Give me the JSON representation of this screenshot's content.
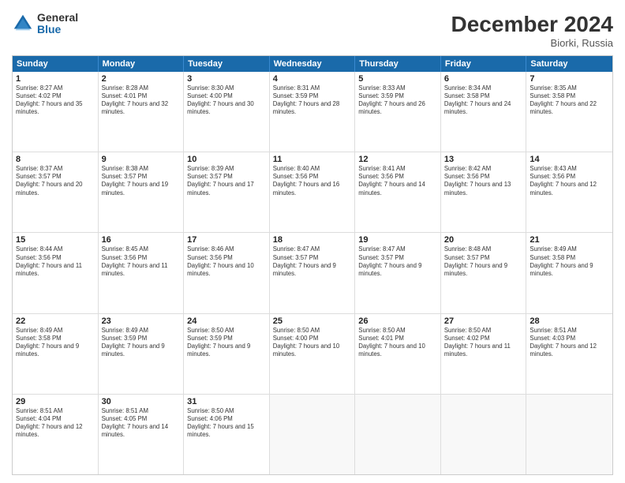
{
  "logo": {
    "general": "General",
    "blue": "Blue"
  },
  "title": "December 2024",
  "location": "Biorki, Russia",
  "days_header": [
    "Sunday",
    "Monday",
    "Tuesday",
    "Wednesday",
    "Thursday",
    "Friday",
    "Saturday"
  ],
  "weeks": [
    [
      {
        "day": "1",
        "sunrise": "Sunrise: 8:27 AM",
        "sunset": "Sunset: 4:02 PM",
        "daylight": "Daylight: 7 hours and 35 minutes."
      },
      {
        "day": "2",
        "sunrise": "Sunrise: 8:28 AM",
        "sunset": "Sunset: 4:01 PM",
        "daylight": "Daylight: 7 hours and 32 minutes."
      },
      {
        "day": "3",
        "sunrise": "Sunrise: 8:30 AM",
        "sunset": "Sunset: 4:00 PM",
        "daylight": "Daylight: 7 hours and 30 minutes."
      },
      {
        "day": "4",
        "sunrise": "Sunrise: 8:31 AM",
        "sunset": "Sunset: 3:59 PM",
        "daylight": "Daylight: 7 hours and 28 minutes."
      },
      {
        "day": "5",
        "sunrise": "Sunrise: 8:33 AM",
        "sunset": "Sunset: 3:59 PM",
        "daylight": "Daylight: 7 hours and 26 minutes."
      },
      {
        "day": "6",
        "sunrise": "Sunrise: 8:34 AM",
        "sunset": "Sunset: 3:58 PM",
        "daylight": "Daylight: 7 hours and 24 minutes."
      },
      {
        "day": "7",
        "sunrise": "Sunrise: 8:35 AM",
        "sunset": "Sunset: 3:58 PM",
        "daylight": "Daylight: 7 hours and 22 minutes."
      }
    ],
    [
      {
        "day": "8",
        "sunrise": "Sunrise: 8:37 AM",
        "sunset": "Sunset: 3:57 PM",
        "daylight": "Daylight: 7 hours and 20 minutes."
      },
      {
        "day": "9",
        "sunrise": "Sunrise: 8:38 AM",
        "sunset": "Sunset: 3:57 PM",
        "daylight": "Daylight: 7 hours and 19 minutes."
      },
      {
        "day": "10",
        "sunrise": "Sunrise: 8:39 AM",
        "sunset": "Sunset: 3:57 PM",
        "daylight": "Daylight: 7 hours and 17 minutes."
      },
      {
        "day": "11",
        "sunrise": "Sunrise: 8:40 AM",
        "sunset": "Sunset: 3:56 PM",
        "daylight": "Daylight: 7 hours and 16 minutes."
      },
      {
        "day": "12",
        "sunrise": "Sunrise: 8:41 AM",
        "sunset": "Sunset: 3:56 PM",
        "daylight": "Daylight: 7 hours and 14 minutes."
      },
      {
        "day": "13",
        "sunrise": "Sunrise: 8:42 AM",
        "sunset": "Sunset: 3:56 PM",
        "daylight": "Daylight: 7 hours and 13 minutes."
      },
      {
        "day": "14",
        "sunrise": "Sunrise: 8:43 AM",
        "sunset": "Sunset: 3:56 PM",
        "daylight": "Daylight: 7 hours and 12 minutes."
      }
    ],
    [
      {
        "day": "15",
        "sunrise": "Sunrise: 8:44 AM",
        "sunset": "Sunset: 3:56 PM",
        "daylight": "Daylight: 7 hours and 11 minutes."
      },
      {
        "day": "16",
        "sunrise": "Sunrise: 8:45 AM",
        "sunset": "Sunset: 3:56 PM",
        "daylight": "Daylight: 7 hours and 11 minutes."
      },
      {
        "day": "17",
        "sunrise": "Sunrise: 8:46 AM",
        "sunset": "Sunset: 3:56 PM",
        "daylight": "Daylight: 7 hours and 10 minutes."
      },
      {
        "day": "18",
        "sunrise": "Sunrise: 8:47 AM",
        "sunset": "Sunset: 3:57 PM",
        "daylight": "Daylight: 7 hours and 9 minutes."
      },
      {
        "day": "19",
        "sunrise": "Sunrise: 8:47 AM",
        "sunset": "Sunset: 3:57 PM",
        "daylight": "Daylight: 7 hours and 9 minutes."
      },
      {
        "day": "20",
        "sunrise": "Sunrise: 8:48 AM",
        "sunset": "Sunset: 3:57 PM",
        "daylight": "Daylight: 7 hours and 9 minutes."
      },
      {
        "day": "21",
        "sunrise": "Sunrise: 8:49 AM",
        "sunset": "Sunset: 3:58 PM",
        "daylight": "Daylight: 7 hours and 9 minutes."
      }
    ],
    [
      {
        "day": "22",
        "sunrise": "Sunrise: 8:49 AM",
        "sunset": "Sunset: 3:58 PM",
        "daylight": "Daylight: 7 hours and 9 minutes."
      },
      {
        "day": "23",
        "sunrise": "Sunrise: 8:49 AM",
        "sunset": "Sunset: 3:59 PM",
        "daylight": "Daylight: 7 hours and 9 minutes."
      },
      {
        "day": "24",
        "sunrise": "Sunrise: 8:50 AM",
        "sunset": "Sunset: 3:59 PM",
        "daylight": "Daylight: 7 hours and 9 minutes."
      },
      {
        "day": "25",
        "sunrise": "Sunrise: 8:50 AM",
        "sunset": "Sunset: 4:00 PM",
        "daylight": "Daylight: 7 hours and 10 minutes."
      },
      {
        "day": "26",
        "sunrise": "Sunrise: 8:50 AM",
        "sunset": "Sunset: 4:01 PM",
        "daylight": "Daylight: 7 hours and 10 minutes."
      },
      {
        "day": "27",
        "sunrise": "Sunrise: 8:50 AM",
        "sunset": "Sunset: 4:02 PM",
        "daylight": "Daylight: 7 hours and 11 minutes."
      },
      {
        "day": "28",
        "sunrise": "Sunrise: 8:51 AM",
        "sunset": "Sunset: 4:03 PM",
        "daylight": "Daylight: 7 hours and 12 minutes."
      }
    ],
    [
      {
        "day": "29",
        "sunrise": "Sunrise: 8:51 AM",
        "sunset": "Sunset: 4:04 PM",
        "daylight": "Daylight: 7 hours and 12 minutes."
      },
      {
        "day": "30",
        "sunrise": "Sunrise: 8:51 AM",
        "sunset": "Sunset: 4:05 PM",
        "daylight": "Daylight: 7 hours and 14 minutes."
      },
      {
        "day": "31",
        "sunrise": "Sunrise: 8:50 AM",
        "sunset": "Sunset: 4:06 PM",
        "daylight": "Daylight: 7 hours and 15 minutes."
      },
      {
        "day": "",
        "sunrise": "",
        "sunset": "",
        "daylight": ""
      },
      {
        "day": "",
        "sunrise": "",
        "sunset": "",
        "daylight": ""
      },
      {
        "day": "",
        "sunrise": "",
        "sunset": "",
        "daylight": ""
      },
      {
        "day": "",
        "sunrise": "",
        "sunset": "",
        "daylight": ""
      }
    ]
  ]
}
